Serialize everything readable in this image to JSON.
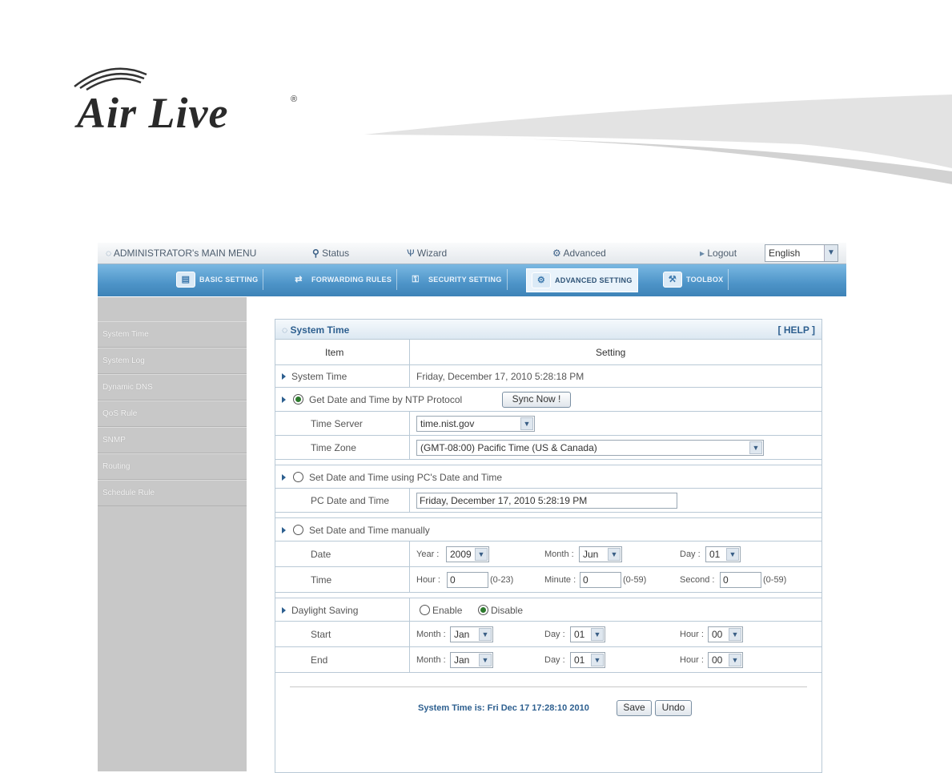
{
  "brand": {
    "logo_text": "Air Live",
    "registered_mark": "®"
  },
  "topmenu": {
    "admin_menu": "ADMINISTRATOR's MAIN MENU",
    "status": "Status",
    "wizard": "Wizard",
    "advanced": "Advanced",
    "logout": "Logout",
    "language": "English"
  },
  "tabs": [
    {
      "label": "BASIC SETTING"
    },
    {
      "label": "FORWARDING RULES"
    },
    {
      "label": "SECURITY SETTING"
    },
    {
      "label": "ADVANCED SETTING"
    },
    {
      "label": "TOOLBOX"
    }
  ],
  "sidebar": {
    "items": [
      {
        "label": "System Time"
      },
      {
        "label": "System Log"
      },
      {
        "label": "Dynamic DNS"
      },
      {
        "label": "QoS Rule"
      },
      {
        "label": "SNMP"
      },
      {
        "label": "Routing"
      },
      {
        "label": "Schedule Rule"
      }
    ]
  },
  "panel": {
    "title": "System Time",
    "help": "[ HELP ]",
    "col_item": "Item",
    "col_setting": "Setting",
    "system_time_label": "System Time",
    "system_time_value": "Friday, December 17, 2010 5:28:18 PM",
    "ntp": {
      "label": "Get Date and Time by NTP Protocol",
      "sync_button": "Sync Now !",
      "server_label": "Time Server",
      "server_value": "time.nist.gov",
      "zone_label": "Time Zone",
      "zone_value": "(GMT-08:00) Pacific Time (US & Canada)"
    },
    "pc": {
      "label": "Set Date and Time using PC's Date and Time",
      "field_label": "PC Date and Time",
      "field_value": "Friday, December 17, 2010 5:28:19 PM"
    },
    "manual": {
      "label": "Set Date and Time manually",
      "date_label": "Date",
      "year_label": "Year :",
      "year_value": "2009",
      "month_label": "Month :",
      "month_value": "Jun",
      "day_label": "Day :",
      "day_value": "01",
      "time_label": "Time",
      "hour_label": "Hour :",
      "hour_value": "0",
      "hour_range": "(0-23)",
      "minute_label": "Minute :",
      "minute_value": "0",
      "minute_range": "(0-59)",
      "second_label": "Second :",
      "second_value": "0",
      "second_range": "(0-59)"
    },
    "dst": {
      "label": "Daylight Saving",
      "enable": "Enable",
      "disable": "Disable",
      "start_label": "Start",
      "end_label": "End",
      "month_label": "Month :",
      "day_label": "Day :",
      "hour_label": "Hour :",
      "start_month": "Jan",
      "start_day": "01",
      "start_hour": "00",
      "end_month": "Jan",
      "end_day": "01",
      "end_hour": "00"
    },
    "footer": {
      "status_text": "System Time is: Fri Dec 17 17:28:10 2010",
      "save": "Save",
      "undo": "Undo"
    }
  }
}
